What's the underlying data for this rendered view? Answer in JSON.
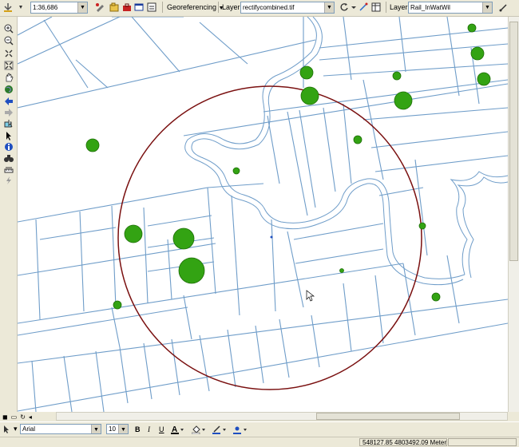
{
  "toolbar": {
    "scale_value": "1:36,686",
    "georef_label": "Georeferencing",
    "layer_label_1": "Layer:",
    "layer_value_1": "rectifycombined.tif",
    "layer_label_2": "Layer:",
    "layer_value_2": "Rail_InWatWil"
  },
  "drawing": {
    "font_value": "Arial",
    "size_value": "10",
    "bold": "B",
    "italic": "I",
    "underline": "U"
  },
  "status": {
    "coordinates": "548127.85  4803492.09 Meters"
  },
  "colors": {
    "parcel_lines": "#6f9dc9",
    "buffer_circle": "#7a1010",
    "points": "#33a313"
  }
}
